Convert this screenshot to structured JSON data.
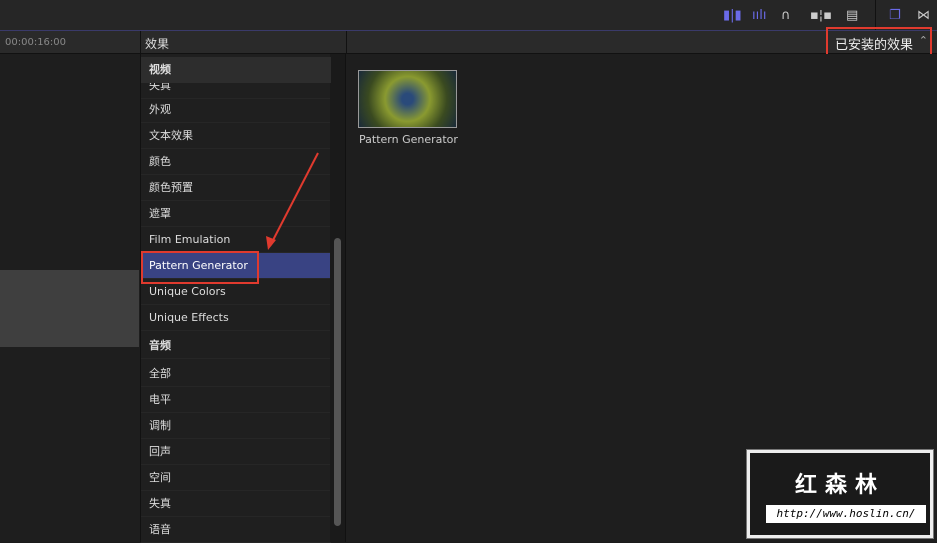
{
  "toolbar": {
    "icons": [
      "clip-view-icon",
      "audio-waveform-icon",
      "headphones-icon",
      "snapping-icon",
      "film-icon",
      "browser-window-icon",
      "transition-icon"
    ]
  },
  "timeline": {
    "timecode": "00:00:16:00"
  },
  "sidebar": {
    "title": "效果",
    "sticky_header": "视频",
    "items": [
      {
        "label": "失真"
      },
      {
        "label": "外观"
      },
      {
        "label": "文本效果"
      },
      {
        "label": "颜色"
      },
      {
        "label": "颜色预置"
      },
      {
        "label": "遮罩"
      },
      {
        "label": "Film Emulation"
      },
      {
        "label": "Pattern Generator",
        "selected": true
      },
      {
        "label": "Unique Colors"
      },
      {
        "label": "Unique Effects"
      },
      {
        "label": "音频",
        "group": true
      },
      {
        "label": "全部"
      },
      {
        "label": "电平"
      },
      {
        "label": "调制"
      },
      {
        "label": "回声"
      },
      {
        "label": "空间"
      },
      {
        "label": "失真"
      },
      {
        "label": "语音"
      }
    ]
  },
  "main": {
    "filter": "已安装的效果",
    "effects": [
      {
        "name": "Pattern Generator"
      }
    ]
  },
  "watermark": {
    "title": "红森林",
    "url": "http://www.hoslin.cn/"
  },
  "colors": {
    "selection": "#394383",
    "highlight": "#e03a2e",
    "accent": "#6a6ae8"
  }
}
